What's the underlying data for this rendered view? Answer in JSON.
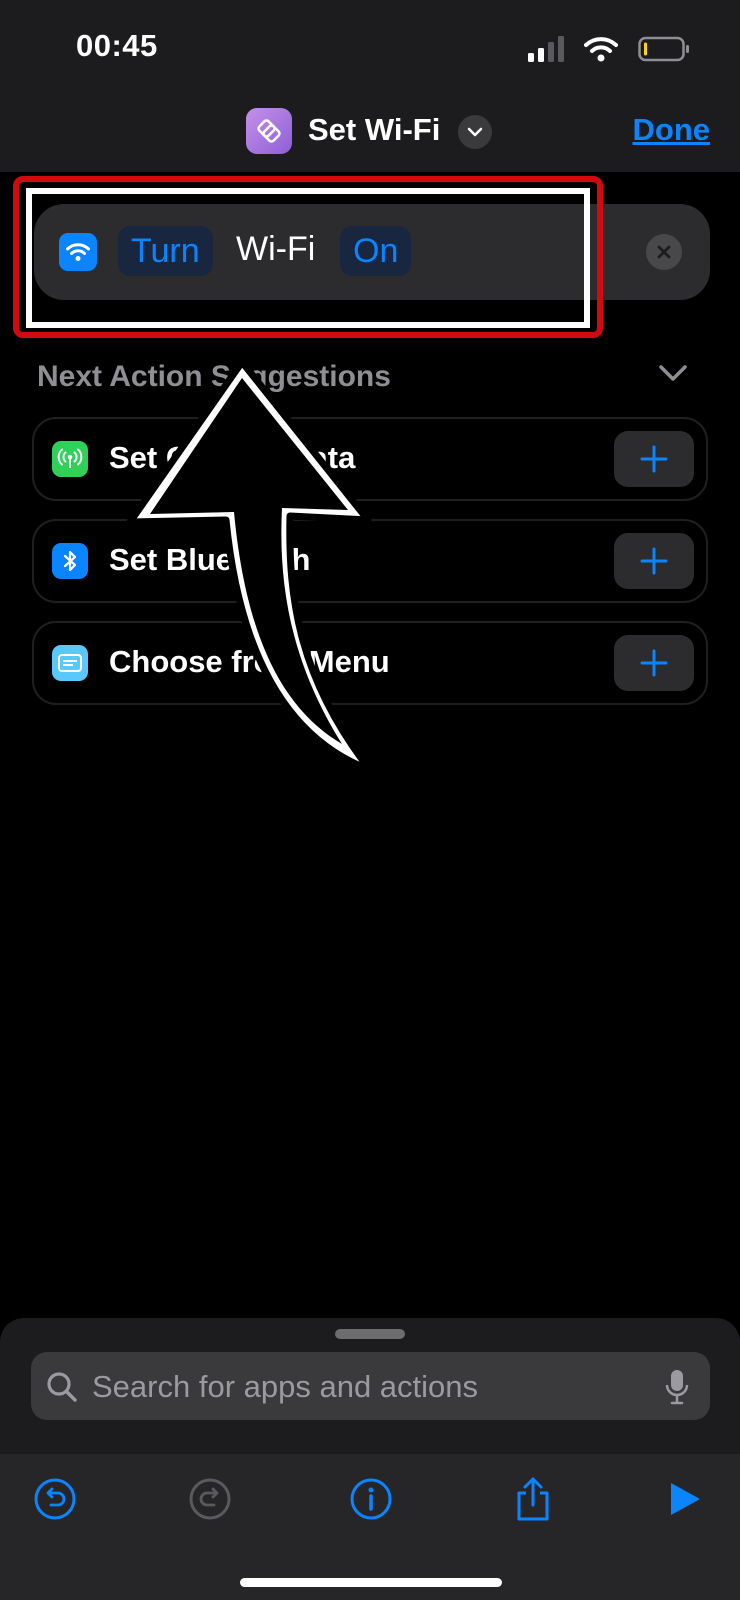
{
  "status_bar": {
    "time": "00:45"
  },
  "header": {
    "title": "Set Wi-Fi",
    "done_label": "Done"
  },
  "action": {
    "verb": "Turn",
    "object": "Wi-Fi",
    "state": "On"
  },
  "suggestions": {
    "title": "Next Action Suggestions",
    "items": [
      {
        "label": "Set Cellular Data",
        "icon": "cellular-antenna-icon",
        "color": "#30d158"
      },
      {
        "label": "Set Bluetooth",
        "icon": "bluetooth-icon",
        "color": "#0a84ff"
      },
      {
        "label": "Choose from Menu",
        "icon": "menu-icon",
        "color": "#5ac8fa"
      }
    ]
  },
  "search": {
    "placeholder": "Search for apps and actions"
  },
  "colors": {
    "accent": "#0a84ff",
    "highlight": "#d10a12",
    "background": "#000000"
  }
}
